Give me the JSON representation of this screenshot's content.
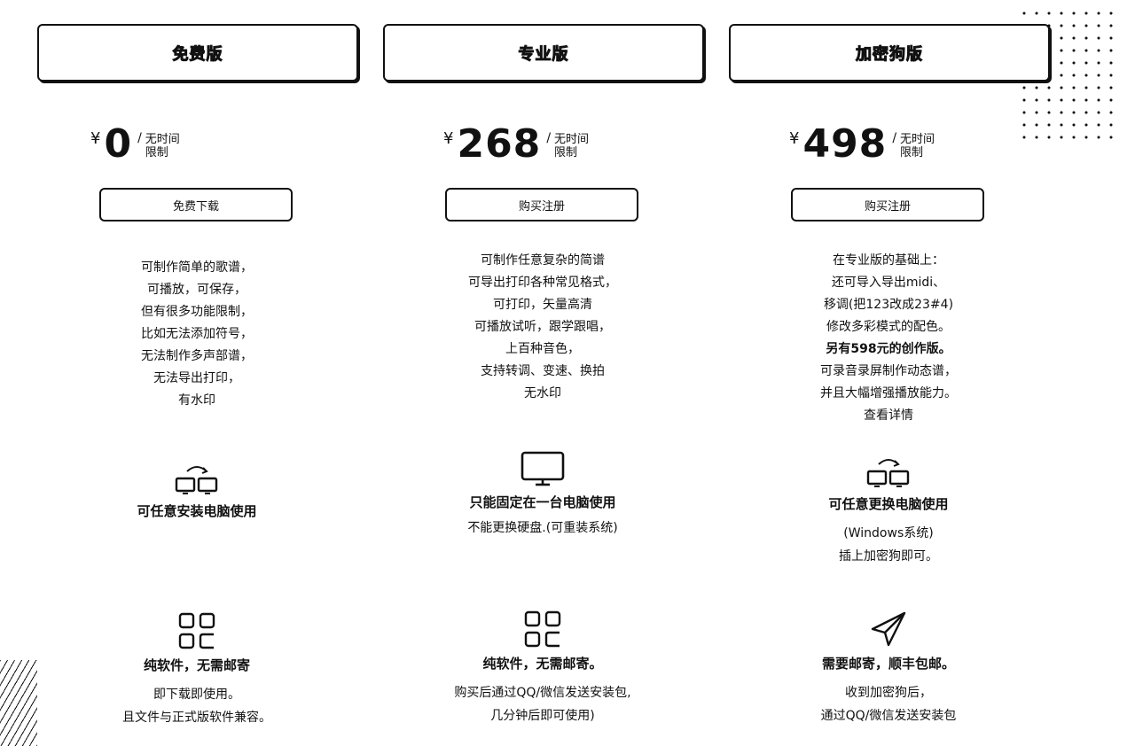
{
  "plans": [
    {
      "title": "免费版",
      "currency": "¥",
      "price": "0",
      "slash": "/",
      "period": "无时间限制",
      "cta": "免费下载",
      "description": [
        "可制作简单的歌谱，",
        "可播放，可保存，",
        "但有很多功能限制，",
        "比如无法添加符号，",
        "无法制作多声部谱，",
        "无法导出打印，",
        "有水印"
      ],
      "device": {
        "icon": "multi-computer-icon",
        "title": "可任意安装电脑使用",
        "note": []
      },
      "delivery": {
        "icon": "apps-grid-icon",
        "title": "纯软件，无需邮寄",
        "note": [
          "即下载即使用。",
          "且文件与正式版软件兼容。"
        ]
      }
    },
    {
      "title": "专业版",
      "currency": "¥",
      "price": "268",
      "slash": "/",
      "period": "无时间限制",
      "cta": "购买注册",
      "description": [
        "可制作任意复杂的简谱",
        "可导出打印各种常见格式，",
        "可打印，矢量高清",
        "可播放试听，跟学跟唱，",
        "上百种音色，",
        "支持转调、变速、换拍",
        "无水印"
      ],
      "device": {
        "icon": "monitor-icon",
        "title": "只能固定在一台电脑使用",
        "note": [
          "不能更换硬盘.(可重装系统)"
        ]
      },
      "delivery": {
        "icon": "apps-grid-icon",
        "title": "纯软件，无需邮寄。",
        "note": [
          "购买后通过QQ/微信发送安装包,",
          "几分钟后即可使用)"
        ]
      }
    },
    {
      "title": "加密狗版",
      "currency": "¥",
      "price": "498",
      "slash": "/",
      "period": "无时间限制",
      "cta": "购买注册",
      "description": [
        "在专业版的基础上：",
        "还可导入导出midi、",
        "移调(把123改成23#4)",
        "修改多彩模式的配色。",
        "另有598元的创作版。",
        "可录音录屏制作动态谱，",
        "并且大幅增强播放能力。",
        "查看详情"
      ],
      "device": {
        "icon": "multi-computer-icon",
        "title": "可任意更换电脑使用",
        "note": [
          "(Windows系统)",
          "插上加密狗即可。"
        ]
      },
      "delivery": {
        "icon": "send-plane-icon",
        "title": "需要邮寄，顺丰包邮。",
        "note": [
          "收到加密狗后，",
          "通过QQ/微信发送安装包"
        ]
      }
    }
  ]
}
